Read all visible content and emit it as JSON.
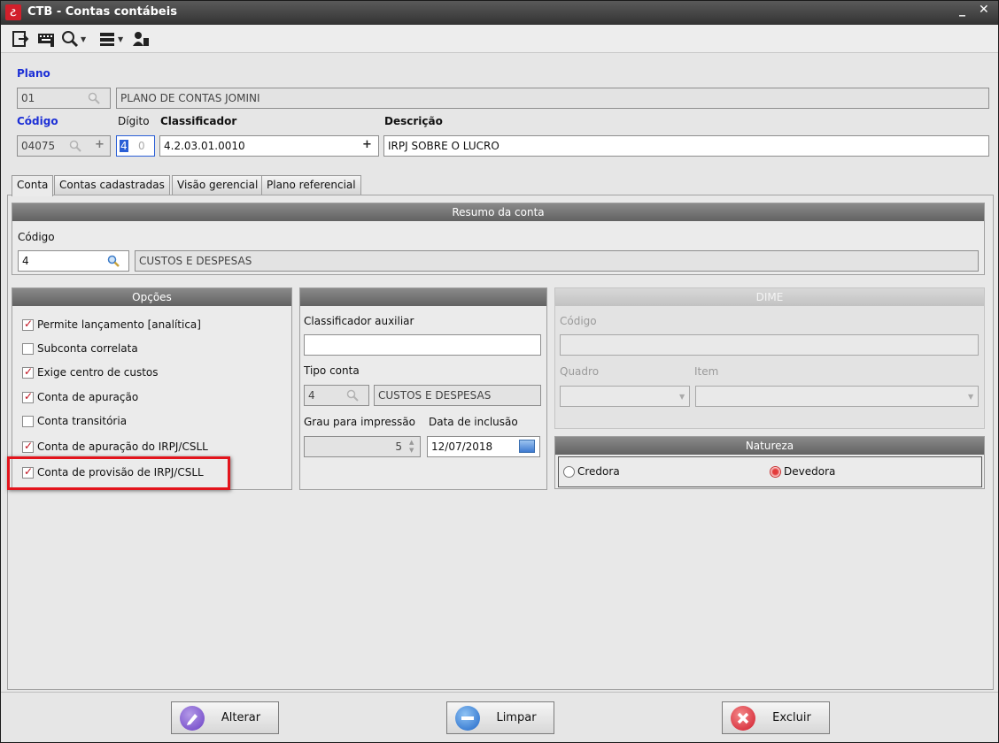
{
  "window": {
    "app_icon_glyph": "ટ",
    "title": "CTB - Contas contábeis",
    "minimize_glyph": "_",
    "close_glyph": "✕"
  },
  "toolbar": {
    "icons": [
      "exit-icon",
      "keyboard-icon",
      "search-icon",
      "list-icon",
      "users-icon"
    ]
  },
  "header": {
    "plano_label": "Plano",
    "plano_code": "01",
    "plano_name": "PLANO DE CONTAS JOMINI",
    "codigo_label": "Código",
    "codigo_value": "04075",
    "digito_label": "Dígito",
    "digito_value_1": "4",
    "digito_value_2": "0",
    "classificador_label": "Classificador",
    "classificador_value": "4.2.03.01.0010",
    "descricao_label": "Descrição",
    "descricao_value": "IRPJ SOBRE O LUCRO"
  },
  "tabs": [
    {
      "label": "Conta",
      "active": true
    },
    {
      "label": "Contas cadastradas",
      "active": false
    },
    {
      "label": "Visão gerencial",
      "active": false
    },
    {
      "label": "Plano referencial",
      "active": false
    }
  ],
  "resumo": {
    "title": "Resumo da conta",
    "codigo_label": "Código",
    "codigo_value": "4",
    "descricao_value": "CUSTOS E DESPESAS"
  },
  "opcoes": {
    "title": "Opções",
    "items": [
      {
        "label": "Permite lançamento [analítica]",
        "checked": true
      },
      {
        "label": "Subconta correlata",
        "checked": false
      },
      {
        "label": "Exige centro de custos",
        "checked": true
      },
      {
        "label": "Conta de apuração",
        "checked": true
      },
      {
        "label": "Conta transitória",
        "checked": false
      },
      {
        "label": "Conta de apuração do IRPJ/CSLL",
        "checked": true
      },
      {
        "label": "Conta de provisão de IRPJ/CSLL",
        "checked": true
      }
    ]
  },
  "middle": {
    "title": "",
    "classificador_auxiliar_label": "Classificador auxiliar",
    "classificador_auxiliar_value": "",
    "tipo_conta_label": "Tipo conta",
    "tipo_conta_code": "4",
    "tipo_conta_desc": "CUSTOS E DESPESAS",
    "grau_label": "Grau para impressão",
    "grau_value": "5",
    "data_label": "Data de inclusão",
    "data_value": "12/07/2018"
  },
  "dime": {
    "title": "DIME",
    "codigo_label": "Código",
    "quadro_label": "Quadro",
    "item_label": "Item"
  },
  "natureza": {
    "title": "Natureza",
    "options": [
      {
        "label": "Credora",
        "checked": false
      },
      {
        "label": "Devedora",
        "checked": true
      }
    ]
  },
  "footer": {
    "alterar_label": "Alterar",
    "limpar_label": "Limpar",
    "excluir_label": "Excluir"
  },
  "colors": {
    "accent_red": "#e3141c",
    "label_blue": "#1c2fd6"
  }
}
